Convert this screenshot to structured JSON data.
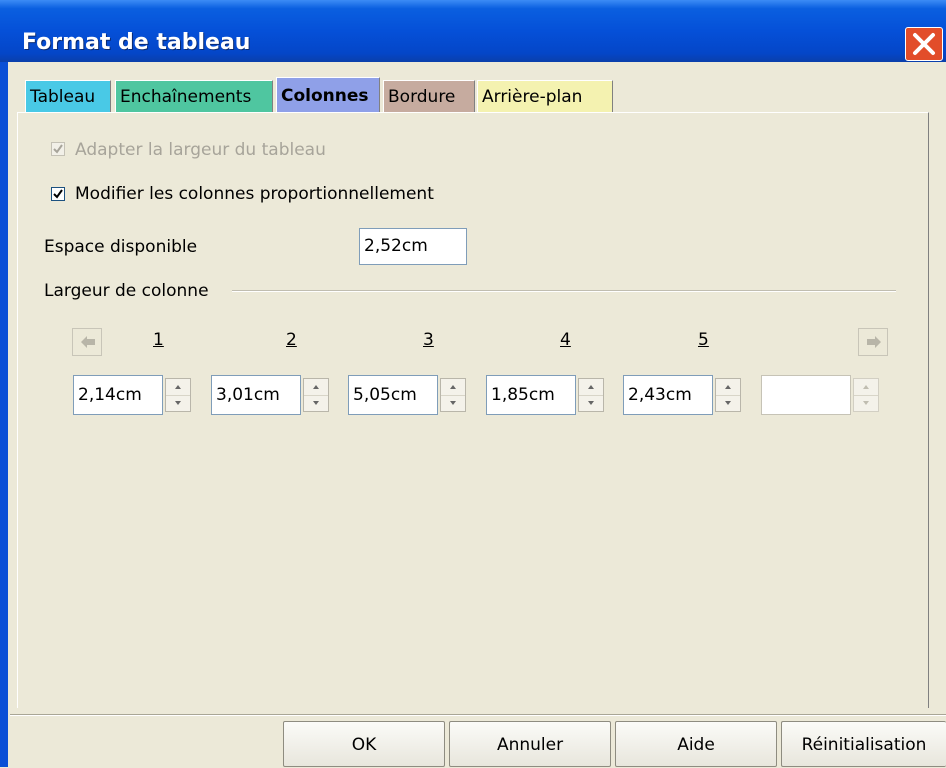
{
  "window": {
    "title": "Format de tableau"
  },
  "tabs": [
    {
      "label": "Tableau",
      "color": "#49c9e6",
      "active": false
    },
    {
      "label": "Enchaînements",
      "color": "#4fc6a0",
      "active": false
    },
    {
      "label": "Colonnes",
      "color": "#8fa0e8",
      "active": true
    },
    {
      "label": "Bordure",
      "color": "#c6ab9f",
      "active": false
    },
    {
      "label": "Arrière-plan",
      "color": "#f4f2b0",
      "active": false
    }
  ],
  "options": {
    "adapt_width": {
      "label": "Adapter la largeur du tableau",
      "checked": true,
      "disabled": true
    },
    "modify_prop": {
      "label": "Modifier les colonnes proportionnellement",
      "checked": true,
      "disabled": false
    }
  },
  "space": {
    "label": "Espace disponible",
    "value": "2,52cm"
  },
  "column_width": {
    "group_label": "Largeur de colonne",
    "numbers": [
      "1",
      "2",
      "3",
      "4",
      "5"
    ],
    "values": [
      "2,14cm",
      "3,01cm",
      "5,05cm",
      "1,85cm",
      "2,43cm",
      ""
    ]
  },
  "buttons": {
    "ok": "OK",
    "cancel": "Annuler",
    "help": "Aide",
    "reset": "Réinitialisation"
  }
}
